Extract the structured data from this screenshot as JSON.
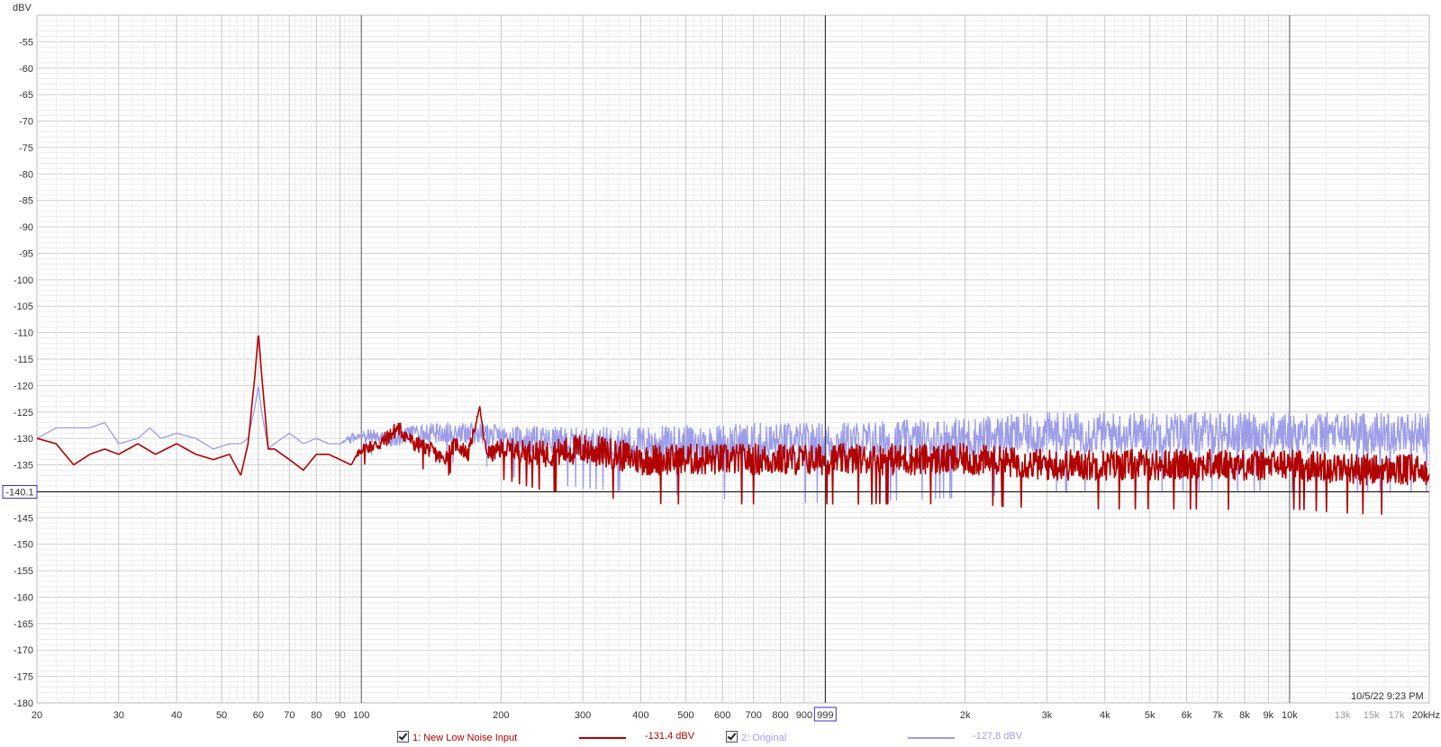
{
  "chart_data": {
    "type": "line",
    "title": "",
    "xlabel": "",
    "ylabel": "dBV",
    "x_scale": "log",
    "xlim": [
      20,
      20000
    ],
    "ylim": [
      -180,
      -50
    ],
    "grid": true,
    "y_ticks": [
      "-55",
      "-60",
      "-65",
      "-70",
      "-75",
      "-80",
      "-85",
      "-90",
      "-95",
      "-100",
      "-105",
      "-110",
      "-115",
      "-120",
      "-125",
      "-130",
      "-135",
      "-145",
      "-150",
      "-155",
      "-160",
      "-165",
      "-170",
      "-175",
      "-180"
    ],
    "y_tick_values": [
      -55,
      -60,
      -65,
      -70,
      -75,
      -80,
      -85,
      -90,
      -95,
      -100,
      -105,
      -110,
      -115,
      -120,
      -125,
      -130,
      -135,
      -145,
      -150,
      -155,
      -160,
      -165,
      -170,
      -175,
      -180
    ],
    "x_ticks": [
      {
        "label": "20",
        "value": 20
      },
      {
        "label": "30",
        "value": 30
      },
      {
        "label": "40",
        "value": 40
      },
      {
        "label": "50",
        "value": 50
      },
      {
        "label": "60",
        "value": 60
      },
      {
        "label": "70",
        "value": 70
      },
      {
        "label": "80",
        "value": 80
      },
      {
        "label": "90",
        "value": 90
      },
      {
        "label": "100",
        "value": 100
      },
      {
        "label": "200",
        "value": 200
      },
      {
        "label": "300",
        "value": 300
      },
      {
        "label": "400",
        "value": 400
      },
      {
        "label": "500",
        "value": 500
      },
      {
        "label": "600",
        "value": 600
      },
      {
        "label": "700",
        "value": 700
      },
      {
        "label": "800",
        "value": 800
      },
      {
        "label": "900",
        "value": 900
      },
      {
        "label": "2k",
        "value": 2000
      },
      {
        "label": "3k",
        "value": 3000
      },
      {
        "label": "4k",
        "value": 4000
      },
      {
        "label": "5k",
        "value": 5000
      },
      {
        "label": "6k",
        "value": 6000
      },
      {
        "label": "7k",
        "value": 7000
      },
      {
        "label": "8k",
        "value": 8000
      },
      {
        "label": "9k",
        "value": 9000
      },
      {
        "label": "10k",
        "value": 10000
      },
      {
        "label": "13k",
        "value": 13000,
        "dim": true
      },
      {
        "label": "15k",
        "value": 15000,
        "dim": true
      },
      {
        "label": "17k",
        "value": 17000,
        "dim": true
      },
      {
        "label": "20kHz",
        "value": 20000
      }
    ],
    "cursor": {
      "x_label": "999",
      "x_value": 999,
      "y_label": "-140.1",
      "y_value": -140.1
    },
    "series": [
      {
        "name": "1: New Low Noise Input",
        "reading": "-131.4 dBV",
        "color": "#b00000",
        "x": [
          20,
          22,
          24,
          26,
          28,
          30,
          33,
          36,
          40,
          44,
          48,
          52,
          55,
          57,
          59,
          60,
          61,
          63,
          65,
          70,
          75,
          80,
          85,
          90,
          95,
          100,
          110,
          120,
          130,
          140,
          150,
          160,
          170,
          180,
          185,
          190,
          200,
          250,
          300,
          350,
          400,
          500,
          700,
          1000,
          1500,
          2000,
          3000,
          4000,
          5000,
          7000,
          10000,
          15000,
          20000
        ],
        "y": [
          -130,
          -131,
          -135,
          -133,
          -132,
          -133,
          -131,
          -133,
          -131,
          -133,
          -134,
          -133,
          -137,
          -131,
          -118,
          -110,
          -118,
          -132,
          -132,
          -134,
          -136,
          -133,
          -133,
          -134,
          -135,
          -132,
          -131,
          -128,
          -131,
          -132,
          -134,
          -131,
          -133,
          -124,
          -132,
          -133,
          -132,
          -133,
          -132,
          -133,
          -134,
          -134,
          -134,
          -134,
          -134,
          -134,
          -135,
          -135,
          -135,
          -135,
          -135,
          -136,
          -136
        ],
        "noise_band_db": [
          0,
          0,
          0,
          0,
          0,
          0,
          0,
          0,
          0,
          0,
          0,
          0,
          0,
          0,
          0,
          0,
          0,
          0,
          0,
          0,
          0,
          0,
          0,
          0,
          0,
          1,
          1.5,
          1.5,
          1.5,
          1.5,
          1.5,
          1.5,
          1.5,
          0,
          1.5,
          1.5,
          2,
          2.5,
          3,
          3,
          3,
          3,
          3,
          3,
          3,
          3,
          3,
          3,
          3,
          3,
          3,
          3,
          3
        ]
      },
      {
        "name": "2: Original",
        "reading": "-127.8 dBV",
        "color": "#9d9de8",
        "x": [
          20,
          22,
          24,
          26,
          28,
          30,
          33,
          35,
          37,
          40,
          44,
          48,
          52,
          55,
          57,
          59,
          60,
          61,
          63,
          65,
          70,
          75,
          80,
          85,
          90,
          95,
          100,
          110,
          120,
          130,
          150,
          180,
          200,
          300,
          500,
          700,
          1000,
          2000,
          3000,
          5000,
          10000,
          20000
        ],
        "y": [
          -130,
          -128,
          -128,
          -128,
          -127,
          -131,
          -130,
          -128,
          -130,
          -129,
          -130,
          -132,
          -131,
          -131,
          -130,
          -124,
          -120,
          -125,
          -132,
          -131,
          -129,
          -131,
          -130,
          -131,
          -131,
          -130,
          -129,
          -130,
          -130,
          -129,
          -129,
          -129,
          -130,
          -131,
          -131,
          -131,
          -131,
          -130,
          -129,
          -129,
          -129,
          -129
        ],
        "noise_band_db": [
          0,
          0,
          0,
          0,
          0,
          0,
          0,
          0,
          0,
          0,
          0,
          0,
          0,
          0,
          0,
          0,
          0,
          0,
          0,
          0,
          0,
          0,
          0,
          0,
          0,
          1,
          1,
          1.5,
          1.5,
          1.5,
          2,
          2,
          2.5,
          3,
          3.5,
          4,
          4,
          4,
          4,
          4,
          4,
          4
        ]
      }
    ]
  },
  "legend": {
    "series1_label": "1: New Low Noise Input",
    "series1_value": "-131.4 dBV",
    "series2_label": "2: Original",
    "series2_value": "-127.8 dBV"
  },
  "timestamp": "10/5/22 9:23 PM",
  "y_unit": "dBV"
}
